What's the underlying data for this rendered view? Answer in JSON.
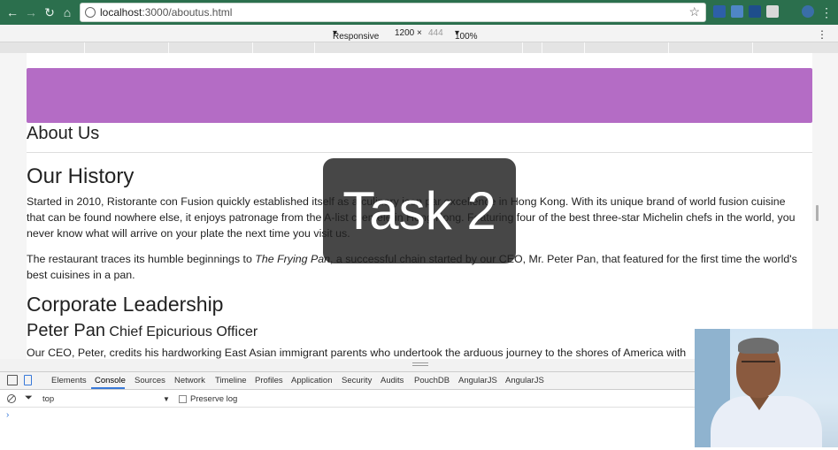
{
  "browser": {
    "url_host": "localhost",
    "url_rest": ":3000/aboutus.html"
  },
  "device_toolbar": {
    "mode": "Responsive",
    "width": "1200",
    "separator": "×",
    "height": "444",
    "zoom": "100%"
  },
  "page": {
    "about_title": "About Us",
    "history_title": "Our History",
    "history_p1": "Started in 2010, Ristorante con Fusion quickly established itself as a culinary icon par excellence in Hong Kong. With its unique brand of world fusion cuisine that can be found nowhere else, it enjoys patronage from the A-list clientele in Hong Kong. Featuring four of the best three-star Michelin chefs in the world, you never know what will arrive on your plate the next time you visit us.",
    "history_p2_start": "The restaurant traces its humble beginnings to ",
    "history_p2_italic": "The Frying Pan",
    "history_p2_end": ", a successful chain started by our CEO, Mr. Peter Pan, that featured for the first time the world's best cuisines in a pan.",
    "leadership_title": "Corporate Leadership",
    "leader_name": "Peter Pan",
    "leader_role": "Chief Epicurious Officer",
    "leader_bio": "Our CEO, Peter, credits his hardworking East Asian immigrant parents who undertook the arduous journey to the shores of America with"
  },
  "overlay": {
    "text": "Task 2"
  },
  "devtools": {
    "tabs": [
      "Elements",
      "Console",
      "Sources",
      "Network",
      "Timeline",
      "Profiles",
      "Application",
      "Security",
      "Audits",
      "PouchDB",
      "AngularJS",
      "AngularJS"
    ],
    "active_tab": "Console",
    "context": "top",
    "context_arrow": "▼",
    "preserve_log": "Preserve log",
    "prompt": "›"
  },
  "colors": {
    "chrome": "#2b6f4d",
    "jumbotron": "#b46cc5",
    "tab_accent": "#3879d9"
  }
}
